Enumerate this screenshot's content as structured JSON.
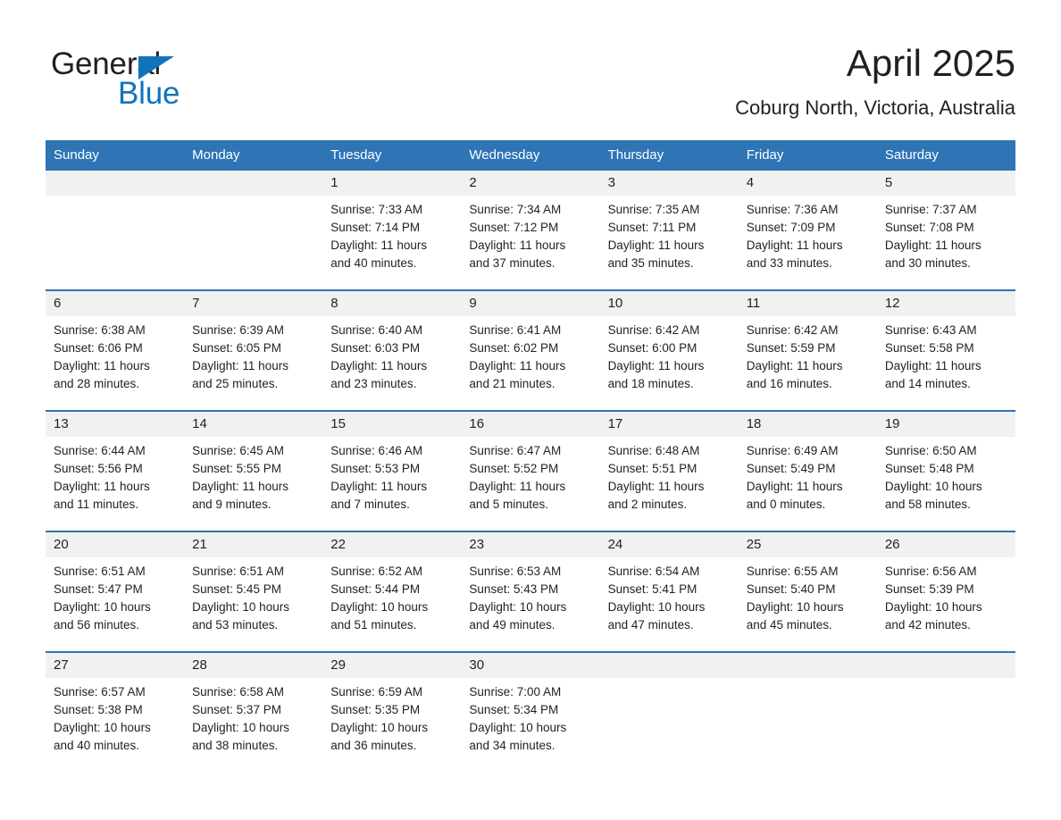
{
  "brand": {
    "logo_part1": "General",
    "logo_part2": "Blue",
    "logo_accent_color": "#1174bb",
    "triangle_icon": "triangle-icon"
  },
  "header": {
    "title": "April 2025",
    "subtitle": "Coburg North, Victoria, Australia"
  },
  "theme": {
    "header_blue": "#2f74b5",
    "day_banner_gray": "#f1f1f1",
    "text_color": "#231f20"
  },
  "calendar": {
    "weekday_headers": [
      "Sunday",
      "Monday",
      "Tuesday",
      "Wednesday",
      "Thursday",
      "Friday",
      "Saturday"
    ],
    "weeks": [
      [
        {
          "day": "",
          "info": ""
        },
        {
          "day": "",
          "info": ""
        },
        {
          "day": "1",
          "info": "Sunrise: 7:33 AM\nSunset: 7:14 PM\nDaylight: 11 hours\nand 40 minutes."
        },
        {
          "day": "2",
          "info": "Sunrise: 7:34 AM\nSunset: 7:12 PM\nDaylight: 11 hours\nand 37 minutes."
        },
        {
          "day": "3",
          "info": "Sunrise: 7:35 AM\nSunset: 7:11 PM\nDaylight: 11 hours\nand 35 minutes."
        },
        {
          "day": "4",
          "info": "Sunrise: 7:36 AM\nSunset: 7:09 PM\nDaylight: 11 hours\nand 33 minutes."
        },
        {
          "day": "5",
          "info": "Sunrise: 7:37 AM\nSunset: 7:08 PM\nDaylight: 11 hours\nand 30 minutes."
        }
      ],
      [
        {
          "day": "6",
          "info": "Sunrise: 6:38 AM\nSunset: 6:06 PM\nDaylight: 11 hours\nand 28 minutes."
        },
        {
          "day": "7",
          "info": "Sunrise: 6:39 AM\nSunset: 6:05 PM\nDaylight: 11 hours\nand 25 minutes."
        },
        {
          "day": "8",
          "info": "Sunrise: 6:40 AM\nSunset: 6:03 PM\nDaylight: 11 hours\nand 23 minutes."
        },
        {
          "day": "9",
          "info": "Sunrise: 6:41 AM\nSunset: 6:02 PM\nDaylight: 11 hours\nand 21 minutes."
        },
        {
          "day": "10",
          "info": "Sunrise: 6:42 AM\nSunset: 6:00 PM\nDaylight: 11 hours\nand 18 minutes."
        },
        {
          "day": "11",
          "info": "Sunrise: 6:42 AM\nSunset: 5:59 PM\nDaylight: 11 hours\nand 16 minutes."
        },
        {
          "day": "12",
          "info": "Sunrise: 6:43 AM\nSunset: 5:58 PM\nDaylight: 11 hours\nand 14 minutes."
        }
      ],
      [
        {
          "day": "13",
          "info": "Sunrise: 6:44 AM\nSunset: 5:56 PM\nDaylight: 11 hours\nand 11 minutes."
        },
        {
          "day": "14",
          "info": "Sunrise: 6:45 AM\nSunset: 5:55 PM\nDaylight: 11 hours\nand 9 minutes."
        },
        {
          "day": "15",
          "info": "Sunrise: 6:46 AM\nSunset: 5:53 PM\nDaylight: 11 hours\nand 7 minutes."
        },
        {
          "day": "16",
          "info": "Sunrise: 6:47 AM\nSunset: 5:52 PM\nDaylight: 11 hours\nand 5 minutes."
        },
        {
          "day": "17",
          "info": "Sunrise: 6:48 AM\nSunset: 5:51 PM\nDaylight: 11 hours\nand 2 minutes."
        },
        {
          "day": "18",
          "info": "Sunrise: 6:49 AM\nSunset: 5:49 PM\nDaylight: 11 hours\nand 0 minutes."
        },
        {
          "day": "19",
          "info": "Sunrise: 6:50 AM\nSunset: 5:48 PM\nDaylight: 10 hours\nand 58 minutes."
        }
      ],
      [
        {
          "day": "20",
          "info": "Sunrise: 6:51 AM\nSunset: 5:47 PM\nDaylight: 10 hours\nand 56 minutes."
        },
        {
          "day": "21",
          "info": "Sunrise: 6:51 AM\nSunset: 5:45 PM\nDaylight: 10 hours\nand 53 minutes."
        },
        {
          "day": "22",
          "info": "Sunrise: 6:52 AM\nSunset: 5:44 PM\nDaylight: 10 hours\nand 51 minutes."
        },
        {
          "day": "23",
          "info": "Sunrise: 6:53 AM\nSunset: 5:43 PM\nDaylight: 10 hours\nand 49 minutes."
        },
        {
          "day": "24",
          "info": "Sunrise: 6:54 AM\nSunset: 5:41 PM\nDaylight: 10 hours\nand 47 minutes."
        },
        {
          "day": "25",
          "info": "Sunrise: 6:55 AM\nSunset: 5:40 PM\nDaylight: 10 hours\nand 45 minutes."
        },
        {
          "day": "26",
          "info": "Sunrise: 6:56 AM\nSunset: 5:39 PM\nDaylight: 10 hours\nand 42 minutes."
        }
      ],
      [
        {
          "day": "27",
          "info": "Sunrise: 6:57 AM\nSunset: 5:38 PM\nDaylight: 10 hours\nand 40 minutes."
        },
        {
          "day": "28",
          "info": "Sunrise: 6:58 AM\nSunset: 5:37 PM\nDaylight: 10 hours\nand 38 minutes."
        },
        {
          "day": "29",
          "info": "Sunrise: 6:59 AM\nSunset: 5:35 PM\nDaylight: 10 hours\nand 36 minutes."
        },
        {
          "day": "30",
          "info": "Sunrise: 7:00 AM\nSunset: 5:34 PM\nDaylight: 10 hours\nand 34 minutes."
        },
        {
          "day": "",
          "info": ""
        },
        {
          "day": "",
          "info": ""
        },
        {
          "day": "",
          "info": ""
        }
      ]
    ]
  }
}
